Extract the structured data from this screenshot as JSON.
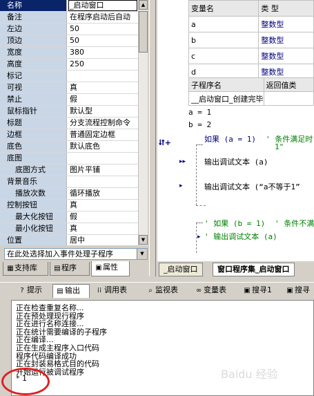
{
  "properties": [
    {
      "name": "名称",
      "value": "_启动窗口",
      "selected": true
    },
    {
      "name": "备注",
      "value": "在程序启动后自动"
    },
    {
      "name": "左边",
      "value": "50"
    },
    {
      "name": "顶边",
      "value": "50"
    },
    {
      "name": "宽度",
      "value": "380"
    },
    {
      "name": "高度",
      "value": "250"
    },
    {
      "name": "标记",
      "value": ""
    },
    {
      "name": "可视",
      "value": "真"
    },
    {
      "name": "禁止",
      "value": "假"
    },
    {
      "name": "鼠标指针",
      "value": "默认型"
    },
    {
      "name": "标题",
      "value": "分支流程控制命令"
    },
    {
      "name": "边框",
      "value": "普通固定边框"
    },
    {
      "name": "底色",
      "value": "默认底色"
    },
    {
      "name": "底图",
      "value": ""
    },
    {
      "name": "底图方式",
      "value": "图片平铺",
      "sub": true
    },
    {
      "name": "背景音乐",
      "value": ""
    },
    {
      "name": "播放次数",
      "value": "循环播放",
      "sub": true
    },
    {
      "name": "控制按钮",
      "value": "真"
    },
    {
      "name": "最大化按钮",
      "value": "假",
      "sub": true
    },
    {
      "name": "最小化按钮",
      "value": "真",
      "sub": true
    },
    {
      "name": "位置",
      "value": "居中"
    }
  ],
  "event_select": "在此处选择加入事件处理子程序",
  "left_tabs": [
    "支持库",
    "程序",
    "属性"
  ],
  "editor": {
    "var_table": {
      "headers": [
        "变量名",
        "类 型"
      ],
      "rows": [
        [
          "a",
          "整数型"
        ],
        [
          "b",
          "整数型"
        ],
        [
          "c",
          "整数型"
        ],
        [
          "d",
          "整数型"
        ]
      ]
    },
    "sub_table": {
      "headers": [
        "子程序名",
        "返回值类"
      ],
      "rows": [
        [
          "__启动窗口_创建完毕",
          ""
        ]
      ]
    },
    "lines": {
      "l1": "a = 1",
      "l2": "b = 2",
      "if1": "如果 (a = 1)",
      "if1_comment": "' 条件满足时",
      "if1_comment2": "1\"",
      "out1": "输出调试文本 (a)",
      "out2": "输出调试文本 (“a不等于1”",
      "if2": "' 如果 (b = 1)",
      "if2_comment": "' 条件不满",
      "out3": "' 输出调试文本 (a)"
    }
  },
  "editor_tabs": [
    "_启动窗口",
    "窗口程序集_启动窗口"
  ],
  "output_tabs": [
    "提示",
    "输出",
    "调用表",
    "监视表",
    "变量表",
    "搜寻1",
    "搜寻"
  ],
  "output_lines": [
    "正在检查重复名称...",
    "正在预处理现行程序",
    "正在进行名称连接...",
    "正在统计需要编译的子程序",
    "正在编译...",
    "正在生成主程序入口代码",
    "程序代码编译成功",
    "正在封装易格式目的代码",
    "开始运行被调试程序",
    "* 1"
  ],
  "watermark": "Baidu 经验"
}
